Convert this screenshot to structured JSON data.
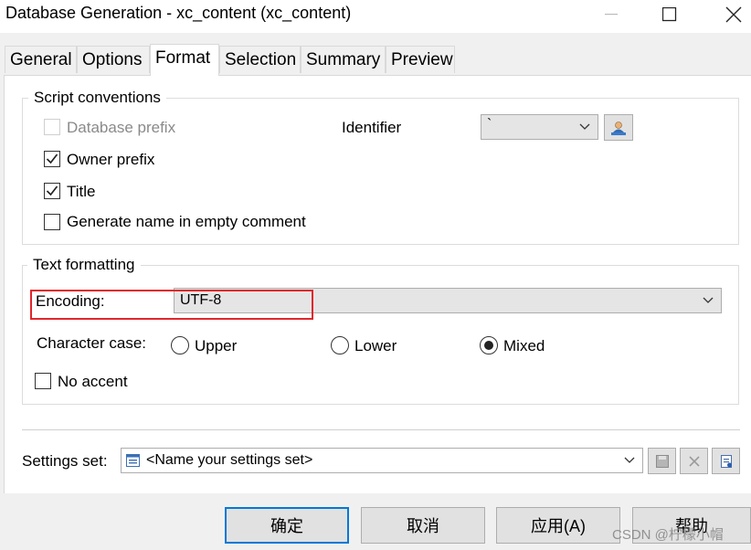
{
  "window": {
    "title": "Database Generation - xc_content (xc_content)",
    "buttons": [
      "minimize",
      "maximize",
      "close"
    ]
  },
  "tabs": [
    {
      "label": "General",
      "active": false
    },
    {
      "label": "Options",
      "active": false
    },
    {
      "label": "Format",
      "active": true
    },
    {
      "label": "Selection",
      "active": false
    },
    {
      "label": "Summary",
      "active": false
    },
    {
      "label": "Preview",
      "active": false
    }
  ],
  "script_conventions": {
    "legend": "Script conventions",
    "database_prefix": {
      "label": "Database prefix",
      "checked": false,
      "enabled": false
    },
    "owner_prefix": {
      "label": "Owner prefix",
      "checked": true
    },
    "title": {
      "label": "Title",
      "checked": true
    },
    "generate_name": {
      "label": "Generate name in empty comment",
      "checked": false
    },
    "identifier": {
      "label": "Identifier",
      "value": "`",
      "button_icon": "user-properties-icon"
    }
  },
  "text_formatting": {
    "legend": "Text formatting",
    "encoding": {
      "label": "Encoding:",
      "value": "UTF-8",
      "highlight_color": "#e0262c"
    },
    "character_case": {
      "label": "Character case:",
      "options": [
        "Upper",
        "Lower",
        "Mixed"
      ],
      "selected": "Mixed"
    },
    "no_accent": {
      "label": "No accent",
      "checked": false
    }
  },
  "settings_set": {
    "label": "Settings set:",
    "value": "<Name your settings set>",
    "icons": [
      "settings-list-icon",
      "save-icon",
      "delete-icon",
      "properties-icon"
    ]
  },
  "footer_buttons": {
    "ok": "确定",
    "cancel": "取消",
    "apply": "应用(A)",
    "help": "帮助"
  },
  "watermark": "CSDN @柠檬小帽"
}
